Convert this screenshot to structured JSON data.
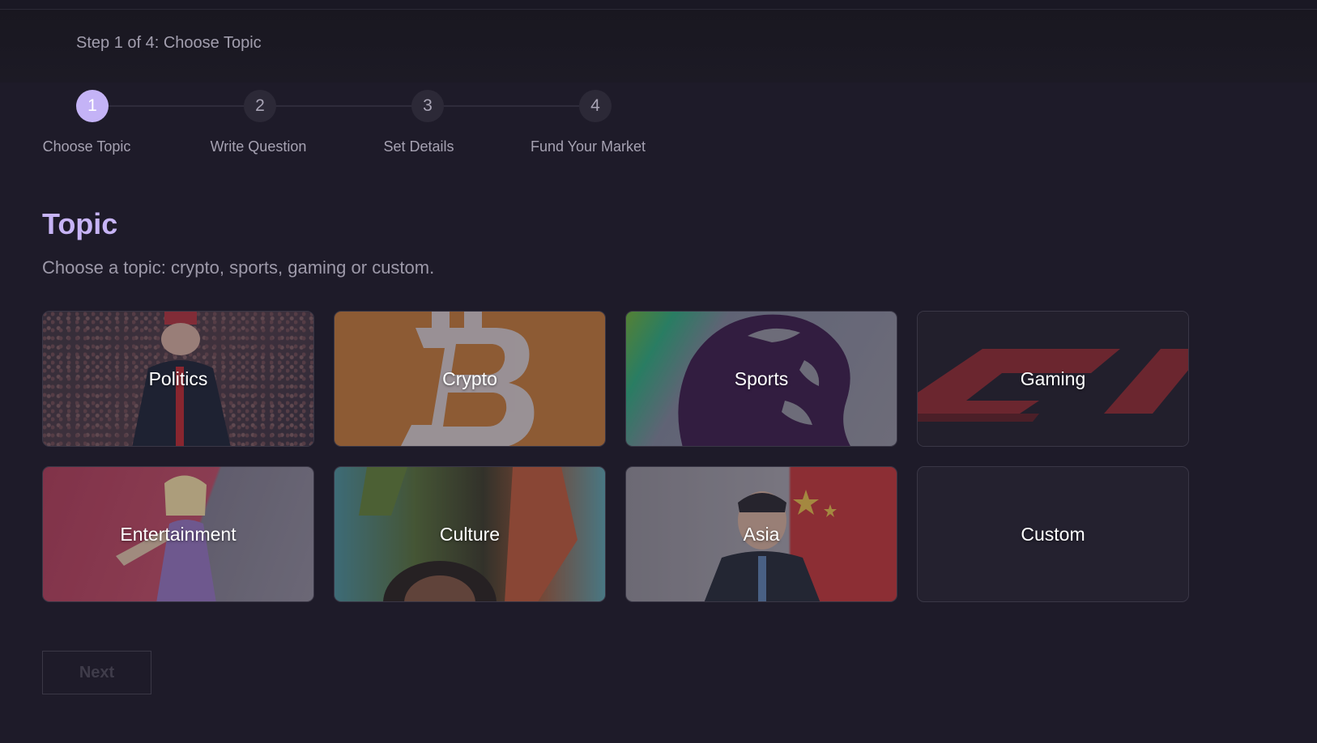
{
  "header": {
    "step_caption": "Step 1 of 4: Choose Topic"
  },
  "stepper": {
    "steps": [
      {
        "number": "1",
        "label": "Choose Topic",
        "active": true
      },
      {
        "number": "2",
        "label": "Write Question",
        "active": false
      },
      {
        "number": "3",
        "label": "Set Details",
        "active": false
      },
      {
        "number": "4",
        "label": "Fund Your Market",
        "active": false
      }
    ]
  },
  "section": {
    "title": "Topic",
    "subtitle": "Choose a topic: crypto, sports, gaming or custom."
  },
  "topics": [
    {
      "label": "Politics",
      "icon": "crowd-rally-image"
    },
    {
      "label": "Crypto",
      "icon": "bitcoin-icon"
    },
    {
      "label": "Sports",
      "icon": "lion-crest-icon"
    },
    {
      "label": "Gaming",
      "icon": "racing-logo-icon"
    },
    {
      "label": "Entertainment",
      "icon": "performer-image"
    },
    {
      "label": "Culture",
      "icon": "collage-image"
    },
    {
      "label": "Asia",
      "icon": "flag-image"
    },
    {
      "label": "Custom",
      "icon": ""
    }
  ],
  "actions": {
    "next_label": "Next"
  },
  "colors": {
    "background": "#1e1b29",
    "accent": "#c4b3f6",
    "muted_text": "#a6a2b2",
    "crypto_orange": "#b9743a",
    "gaming_red": "#b3303a"
  }
}
